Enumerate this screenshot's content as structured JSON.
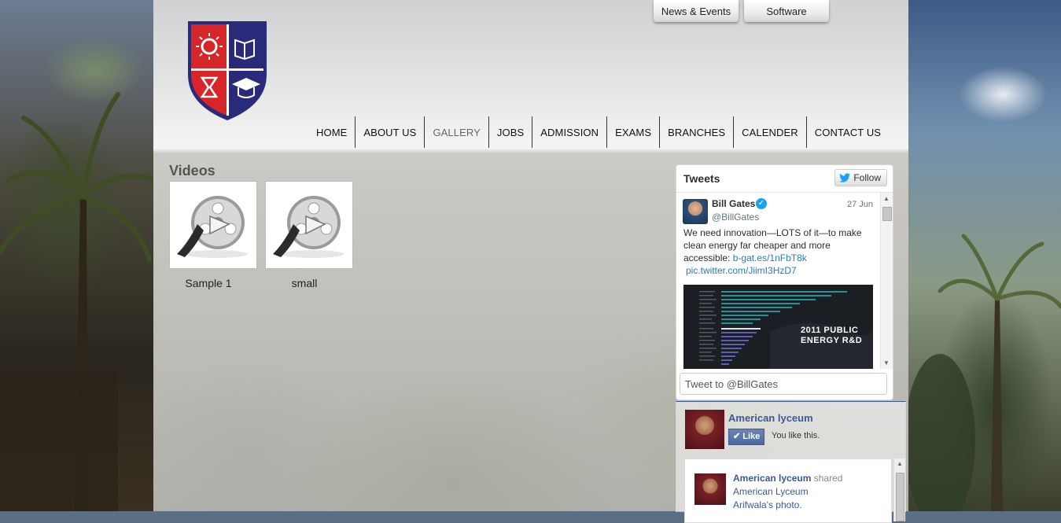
{
  "top_links": [
    {
      "label": "News & Events"
    },
    {
      "label": "Software"
    }
  ],
  "nav": {
    "items": [
      {
        "label": "HOME"
      },
      {
        "label": "ABOUT US"
      },
      {
        "label": "GALLERY"
      },
      {
        "label": "JOBS"
      },
      {
        "label": "ADMISSION"
      },
      {
        "label": "EXAMS"
      },
      {
        "label": "BRANCHES"
      },
      {
        "label": "CALENDER"
      },
      {
        "label": "CONTACT US"
      }
    ],
    "active": "GALLERY"
  },
  "videos": {
    "title": "Videos",
    "items": [
      {
        "label": "Sample 1",
        "icon": "film-reel-icon"
      },
      {
        "label": "small",
        "icon": "film-reel-icon"
      }
    ]
  },
  "twitter": {
    "title": "Tweets",
    "follow_label": "Follow",
    "tweet": {
      "name": "Bill Gates",
      "handle": "@BillGates",
      "date": "27 Jun",
      "text": "We need innovation—LOTS of it—to make clean energy far cheaper and more accessible:",
      "link1": "b-gat.es/1nFbT8k",
      "link2": "pic.twitter.com/JiimI3HzD7",
      "image_caption_1": "2011 PUBLIC",
      "image_caption_2": "ENERGY R&D"
    },
    "input_placeholder": "Tweet to @BillGates"
  },
  "facebook": {
    "page_name": "American lyceum",
    "like_label": "Like",
    "likes_text": "You like this.",
    "post": {
      "author": "American lyceum",
      "verb": "shared",
      "line2": "American Lyceum",
      "line3": "Arifwala's photo."
    }
  },
  "colors": {
    "facebook_blue": "#3b5998",
    "twitter_blue": "#1da1f2",
    "logo_red": "#d7262a",
    "logo_navy": "#2a2a7a"
  }
}
